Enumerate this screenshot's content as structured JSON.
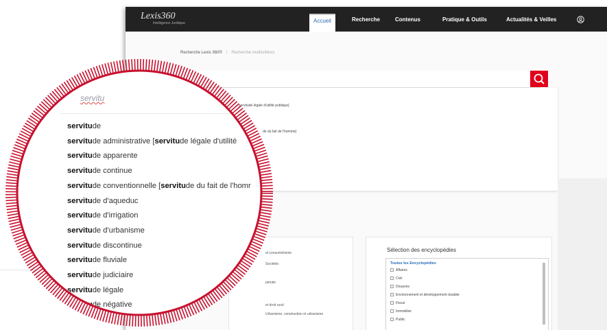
{
  "app": {
    "logo_text": "Lexis360",
    "logo_subtext": "Intelligence Juridique"
  },
  "nav": {
    "items": [
      "Accueil",
      "Recherche",
      "Contenus",
      "Pratique & Outils",
      "Actualités & Veilles"
    ],
    "active": "Accueil",
    "user_icon": "user-circle-icon"
  },
  "breadcrumb": {
    "item1": "Recherche Lexis 360®",
    "item2": "Recherche multicritères"
  },
  "search": {
    "value": "servitu",
    "button_icon": "search-icon",
    "button_color": "#e2001a"
  },
  "suggestions": {
    "bold_prefix": "servitu",
    "items": [
      {
        "prefix": "servitu",
        "rest": "de",
        "tail": ""
      },
      {
        "prefix": "servitu",
        "rest": "de administrative [",
        "prefix2": "servitu",
        "tail": "de légale d'utilité"
      },
      {
        "prefix": "servitu",
        "rest": "de apparente",
        "tail": ""
      },
      {
        "prefix": "servitu",
        "rest": "de continue",
        "tail": ""
      },
      {
        "prefix": "servitu",
        "rest": "de conventionnelle [",
        "prefix2": "servitu",
        "tail": "de du fait de l'homr"
      },
      {
        "prefix": "servitu",
        "rest": "de d'aqueduc",
        "tail": ""
      },
      {
        "prefix": "servitu",
        "rest": "de d'irrigation",
        "tail": ""
      },
      {
        "prefix": "servitu",
        "rest": "de d'urbanisme",
        "tail": ""
      },
      {
        "prefix": "servitu",
        "rest": "de discontinue",
        "tail": ""
      },
      {
        "prefix": "servitu",
        "rest": "de fluviale",
        "tail": ""
      },
      {
        "prefix": "servitu",
        "rest": "de judiciaire",
        "tail": ""
      },
      {
        "prefix": "servitu",
        "rest": "de légale",
        "tail": ""
      },
      {
        "prefix": "servitu",
        "rest": "de négative",
        "tail": ""
      }
    ],
    "background_snippets": [
      "servitude légale d'utilité publique]",
      "de du fait de l'homme]"
    ]
  },
  "left_panel": {
    "snippets": [
      "et consumérisme",
      "Sociétés",
      "pénale",
      "et droit rural",
      "Urbanisme, construction et urbanisme"
    ]
  },
  "encyclopedias": {
    "title": "Sélection des encyclopédies",
    "all_label": "Toutes les Encyclopédies",
    "items": [
      "Affaires",
      "Civil",
      "Douanes",
      "Environnement et développement durable",
      "Fiscal",
      "Immobilier",
      "Public"
    ]
  },
  "colors": {
    "ring": "#c8102e",
    "accent": "#e2001a",
    "link_blue": "#2a6db8",
    "nav_bg": "#222222"
  }
}
